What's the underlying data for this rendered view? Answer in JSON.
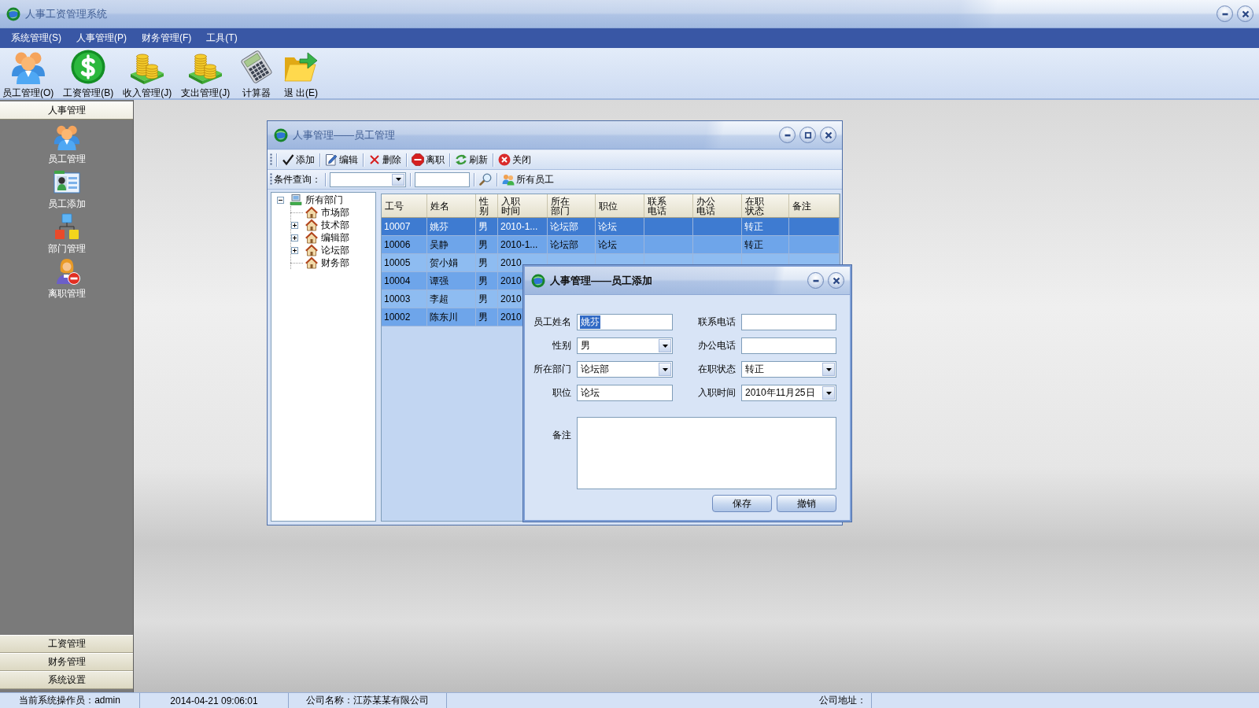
{
  "window": {
    "title": "人事工资管理系统"
  },
  "menu": [
    "系统管理(S)",
    "人事管理(P)",
    "财务管理(F)",
    "工具(T)"
  ],
  "toolbar": [
    "员工管理(O)",
    "工资管理(B)",
    "收入管理(J)",
    "支出管理(J)",
    "计算器",
    "退 出(E)"
  ],
  "sidebar": {
    "sections": [
      {
        "label": "人事管理",
        "expanded": true,
        "items": [
          "员工管理",
          "员工添加",
          "部门管理",
          "离职管理"
        ]
      },
      {
        "label": "工资管理",
        "expanded": false
      },
      {
        "label": "财务管理",
        "expanded": false
      },
      {
        "label": "系统设置",
        "expanded": false
      }
    ]
  },
  "employee_window": {
    "title": "人事管理——员工管理",
    "toolbar": [
      "添加",
      "编辑",
      "删除",
      "离职",
      "刷新",
      "关闭"
    ],
    "filter_label": "条件查询：",
    "show_all_button": "所有员工",
    "tree": {
      "label": "所有部门",
      "kind": "branch",
      "expanded": true,
      "children": [
        {
          "label": "市场部",
          "kind": "leaf"
        },
        {
          "label": "技术部",
          "kind": "branch",
          "expanded": false
        },
        {
          "label": "编辑部",
          "kind": "branch",
          "expanded": false
        },
        {
          "label": "论坛部",
          "kind": "branch",
          "expanded": false
        },
        {
          "label": "财务部",
          "kind": "leaf"
        }
      ]
    },
    "table": {
      "columns": [
        "工号",
        "姓名",
        "性别",
        "入职时间",
        "所在部门",
        "职位",
        "联系电话",
        "办公电话",
        "在职状态",
        "备注"
      ],
      "rows": [
        {
          "selected": true,
          "id": "10007",
          "name": "姚芬",
          "gender": "男",
          "hire_date": "2010-1...",
          "department": "论坛部",
          "position": "论坛",
          "status": "转正"
        },
        {
          "selected": false,
          "id": "10006",
          "name": "吴静",
          "gender": "男",
          "hire_date": "2010-1...",
          "department": "论坛部",
          "position": "论坛",
          "status": "转正"
        },
        {
          "selected": false,
          "id": "10005",
          "name": "贺小娟",
          "gender": "男",
          "hire_date": "2010"
        },
        {
          "selected": false,
          "id": "10004",
          "name": "谭强",
          "gender": "男",
          "hire_date": "2010"
        },
        {
          "selected": false,
          "id": "10003",
          "name": "李超",
          "gender": "男",
          "hire_date": "2010"
        },
        {
          "selected": false,
          "id": "10002",
          "name": "陈东川",
          "gender": "男",
          "hire_date": "2010"
        }
      ]
    }
  },
  "dialog": {
    "title": "人事管理——员工添加",
    "fields": [
      {
        "label": "员工姓名",
        "kind": "text",
        "value": "姚芬",
        "highlighted": true
      },
      {
        "label": "联系电话",
        "kind": "text"
      },
      {
        "label": "性别",
        "kind": "dropdown",
        "value": "男",
        "highlighted": false
      },
      {
        "label": "办公电话",
        "kind": "text"
      },
      {
        "label": "所在部门",
        "kind": "dropdown",
        "value": "论坛部",
        "highlighted": false
      },
      {
        "label": "在职状态",
        "kind": "dropdown",
        "value": "转正",
        "highlighted": false
      },
      {
        "label": "职位",
        "kind": "text",
        "value": "论坛",
        "highlighted": false
      },
      {
        "label": "入职时间",
        "kind": "dropdown",
        "value": "2010年11月25日",
        "highlighted": false
      },
      {
        "label": "备注",
        "kind": "textarea"
      }
    ],
    "buttons": [
      "保存",
      "撤销"
    ]
  },
  "status_bar": [
    "当前系统操作员：admin",
    "2014-04-21 09:06:01",
    "公司名称：江苏某某有限公司",
    "公司地址："
  ]
}
